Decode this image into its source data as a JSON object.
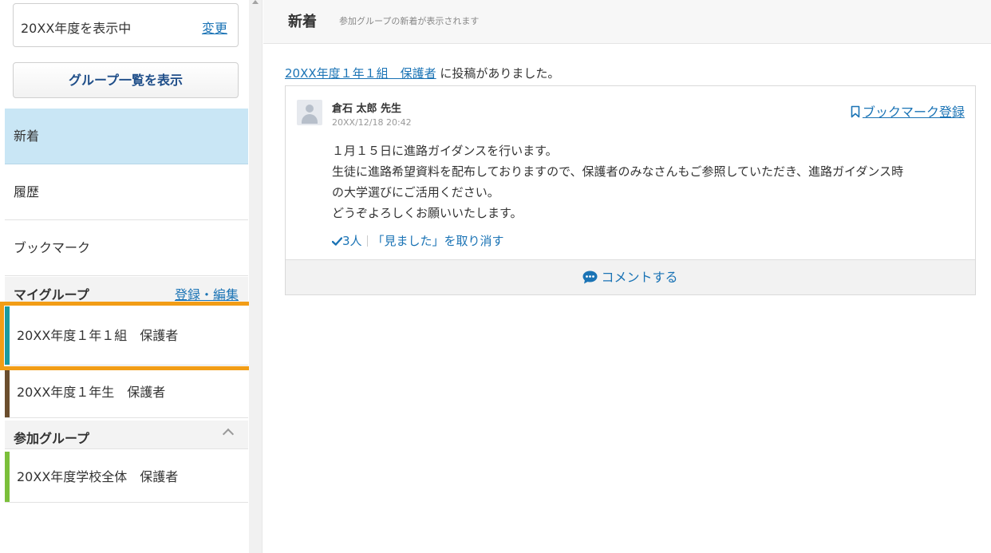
{
  "sidebar": {
    "year_text": "20XX年度を表示中",
    "year_change": "変更",
    "group_list_button": "グループ一覧を表示",
    "nav": {
      "new": "新着",
      "history": "履歴",
      "bookmark": "ブックマーク"
    },
    "my_group": {
      "title": "マイグループ",
      "edit_link": "登録・編集",
      "items": [
        {
          "label": "20XX年度１年１組　保護者",
          "color": "#1a9aa0"
        },
        {
          "label": "20XX年度１年生　保護者",
          "color": "#6b4e2e"
        }
      ]
    },
    "joined_group": {
      "title": "参加グループ",
      "items": [
        {
          "label": "20XX年度学校全体　保護者",
          "color": "#7bbf3a"
        }
      ]
    }
  },
  "header": {
    "title": "新着",
    "subtitle": "参加グループの新着が表示されます"
  },
  "notice": {
    "group_link": "20XX年度１年１組　保護者",
    "text": " に投稿がありました。"
  },
  "post": {
    "author": "倉石 太郎 先生",
    "time": "20XX/12/18 20:42",
    "bookmark_label": "ブックマーク登録",
    "body": [
      "１月１５日に進路ガイダンスを行います。",
      "生徒に進路希望資料を配布しておりますので、保護者のみなさんもご参照していただき、進路ガイダンス時",
      "の大学選びにご活用ください。",
      "どうぞよろしくお願いいたします。"
    ],
    "seen_count": "3人",
    "unsee_label": "「見ました」を取り消す",
    "comment_label": "コメントする"
  },
  "colors": {
    "accent": "#1a73b5",
    "active_nav": "#c9e6f5",
    "highlight": "#f29d16"
  }
}
